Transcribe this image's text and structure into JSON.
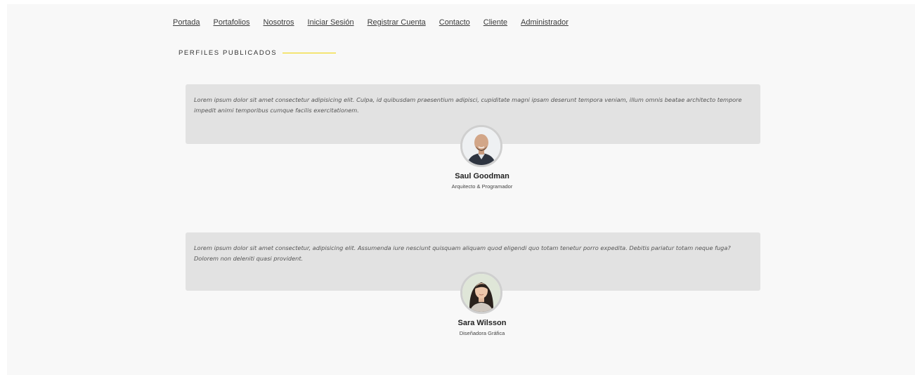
{
  "nav": {
    "items": [
      {
        "label": "Portada"
      },
      {
        "label": "Portafolios"
      },
      {
        "label": "Nosotros"
      },
      {
        "label": "Iniciar Sesión"
      },
      {
        "label": "Registrar Cuenta"
      },
      {
        "label": "Contacto"
      },
      {
        "label": "Cliente"
      },
      {
        "label": "Administrador"
      }
    ]
  },
  "section": {
    "title": "PERFILES PUBLICADOS"
  },
  "profiles": [
    {
      "quote": "Lorem ipsum dolor sit amet consectetur adipisicing elit. Culpa, id quibusdam praesentium adipisci, cupiditate magni ipsam deserunt tempora veniam, illum omnis beatae architecto tempore impedit animi temporibus cumque facilis exercitationem.",
      "name": "Saul Goodman",
      "role": "Arquitecto & Programador"
    },
    {
      "quote": "Lorem ipsum dolor sit amet consectetur, adipisicing elit. Assumenda iure nesciunt quisquam aliquam quod eligendi quo totam tenetur porro expedita. Debitis pariatur totam neque fuga? Dolorem non deleniti quasi provident.",
      "name": "Sara Wilsson",
      "role": "Diseñadora Gráfica"
    }
  ],
  "colors": {
    "accent_line": "#f0d400",
    "card_bg": "#e2e2e2",
    "page_bg": "#f8f8f8"
  }
}
